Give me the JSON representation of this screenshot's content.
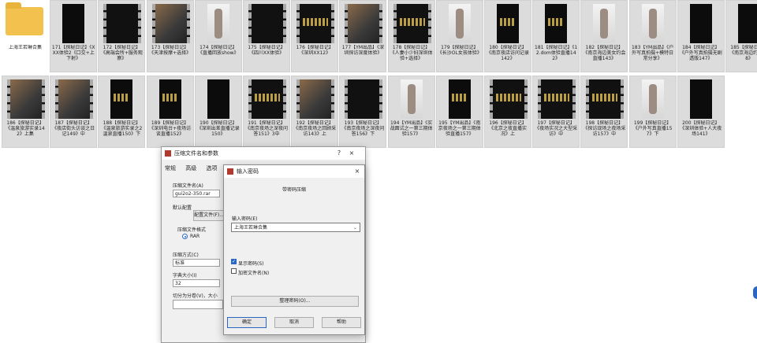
{
  "files": [
    {
      "type": "folder",
      "caption": "上海王若琳合集"
    },
    {
      "type": "phone-dark",
      "caption": "171【探秘日记】《XXX体验2《口交+上下射》"
    },
    {
      "type": "film",
      "caption": "172【探秘日记】《高端会所+服务观察》"
    },
    {
      "type": "film-photo",
      "caption": "173【探秘日记】《天津按摩+选择》"
    },
    {
      "type": "phone-photo",
      "caption": "174【探秘日记】《直播回放show》"
    },
    {
      "type": "film",
      "caption": "175【探秘日记】《四川XX体验》"
    },
    {
      "type": "film-gold",
      "caption": "176【探秘日记】《深圳XX12》"
    },
    {
      "type": "film-scene",
      "caption": "177【YM出品】《深圳探访深度体验》"
    },
    {
      "type": "film-gold",
      "caption": "178【探秘日记】《人妻小少妇深圳体验+选择》"
    },
    {
      "type": "phone-photo",
      "caption": "179【探秘日记】《长沙OL女孩体验》"
    },
    {
      "type": "phone-gold",
      "caption": "180【探秘日记】《南京夜店访问记录142》"
    },
    {
      "type": "phone-gold",
      "caption": "181【探秘日记】《12.dom体验直播142》"
    },
    {
      "type": "phone-photo",
      "caption": "182【探秘日记】《南京海边美女约会直播143》"
    },
    {
      "type": "phone-photo",
      "caption": "183【YM出品】《户外写真拍摄+模特日常分享》"
    },
    {
      "type": "phone-dark",
      "caption": "184【探秘日记】《户外写真拍摄无剧透版147》"
    },
    {
      "type": "phone-dark",
      "caption": "185【探秘日记】《南京海边约会148》"
    },
    {
      "type": "film-scene",
      "caption": "186【探秘日记】《温泉旅游实录142》上集"
    },
    {
      "type": "film-scene",
      "caption": "187【探秘日记】《夜店街头访谈之日记149》中"
    },
    {
      "type": "phone-gold",
      "caption": "188【探秘日记】《温泉旅游实录之2温泉直播150》下"
    },
    {
      "type": "phone-gold",
      "caption": "189【探秘日记】《深圳电台+夜场访谈直播152》"
    },
    {
      "type": "phone-dark",
      "caption": "190【探秘日记】《深圳出差直播记录150》"
    },
    {
      "type": "film-gold",
      "caption": "191【探秘日记】《南京夜场之深夜问答151》3中"
    },
    {
      "type": "film-scene",
      "caption": "192【探秘日记】《南京夜场之回顾采访143》上"
    },
    {
      "type": "film",
      "caption": "193【探秘日记】《南京夜场之深夜问答156》下"
    },
    {
      "type": "phone-photo",
      "caption": "194【YM出品】《实战面试之一第三期体验157》"
    },
    {
      "type": "phone-gold",
      "caption": "195【YM出品】《南京夜场之一第三期体验直播157》"
    },
    {
      "type": "film-gold",
      "caption": "196【探秘日记】《北京之夜直播实况》上"
    },
    {
      "type": "film-gold",
      "caption": "197【探秘日记】《夜场实况之大型采访》中"
    },
    {
      "type": "film-gold",
      "caption": "198【探秘日记】《探访现场之夜场采访157》中"
    },
    {
      "type": "phone-photo",
      "caption": "199【探秘日记】《户外写真直播157》下"
    },
    {
      "type": "phone-dark",
      "caption": "200【探秘日记】《深圳体验+人大夜场141》"
    }
  ],
  "dialog_compress": {
    "title": "压缩文件名和参数",
    "tabs": [
      "常规",
      "高级",
      "选项"
    ],
    "archive_name_label": "压缩文件名(A)",
    "archive_name_value": "gui2o2-350.rar",
    "profile_label": "默认配置",
    "profile_button": "配置文件(F)...",
    "format_label": "压缩文件格式",
    "format_option": "RAR",
    "method_label": "压缩方式(C)",
    "method_value": "标准",
    "dict_label": "字典大小(I)",
    "dict_value": "32",
    "split_label": "切分为分卷(V)，大小"
  },
  "dialog_password": {
    "title": "输入密码",
    "heading": "带密码压缩",
    "password_label": "输入密码(E)",
    "password_value": "上海王若琳合集",
    "show_password_label": "显示密码(S)",
    "show_password_checked": true,
    "encrypt_names_label": "加密文件名(N)",
    "encrypt_names_checked": false,
    "organize_button": "整理密码(O)...",
    "ok_button": "确定",
    "cancel_button": "取消",
    "help_button": "帮助"
  },
  "colors": {
    "accent": "#2a66c4",
    "folder": "#f2c14e",
    "tile_bg": "#dcdcdc"
  }
}
